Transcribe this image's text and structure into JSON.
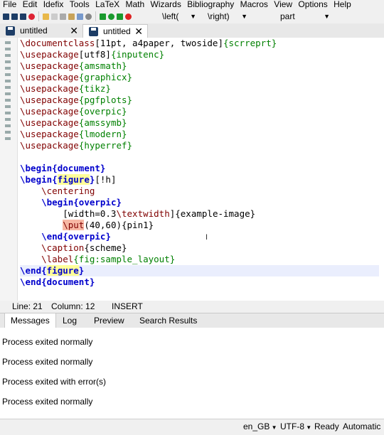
{
  "menu": [
    "File",
    "Edit",
    "Idefix",
    "Tools",
    "LaTeX",
    "Math",
    "Wizards",
    "Bibliography",
    "Macros",
    "View",
    "Options",
    "Help"
  ],
  "toolbar": {
    "left_combo": "\\left(",
    "right_combo": "\\right)",
    "structure_combo": "part"
  },
  "tabs": [
    {
      "label": "untitled",
      "close": "✕"
    },
    {
      "label": "untitled",
      "close": "✕"
    }
  ],
  "editor": {
    "lines": [
      [
        [
          "cmd",
          "\\documentclass"
        ],
        [
          "plain",
          "[11pt, a4paper, twoside]"
        ],
        [
          "arg",
          "{scrreprt}"
        ]
      ],
      [
        [
          "cmd",
          "\\usepackage"
        ],
        [
          "plain",
          "[utf8]"
        ],
        [
          "arg",
          "{inputenc}"
        ]
      ],
      [
        [
          "cmd",
          "\\usepackage"
        ],
        [
          "arg",
          "{amsmath}"
        ]
      ],
      [
        [
          "cmd",
          "\\usepackage"
        ],
        [
          "arg",
          "{graphicx}"
        ]
      ],
      [
        [
          "cmd",
          "\\usepackage"
        ],
        [
          "arg",
          "{tikz}"
        ]
      ],
      [
        [
          "cmd",
          "\\usepackage"
        ],
        [
          "arg",
          "{pgfplots}"
        ]
      ],
      [
        [
          "cmd",
          "\\usepackage"
        ],
        [
          "arg",
          "{overpic}"
        ]
      ],
      [
        [
          "cmd",
          "\\usepackage"
        ],
        [
          "arg",
          "{amssymb}"
        ]
      ],
      [
        [
          "cmd",
          "\\usepackage"
        ],
        [
          "arg",
          "{lmodern}"
        ]
      ],
      [
        [
          "cmd",
          "\\usepackage"
        ],
        [
          "arg",
          "{hyperref}"
        ]
      ],
      [],
      [
        [
          "env",
          "\\begin{"
        ],
        [
          "envname",
          "document"
        ],
        [
          "env",
          "}"
        ]
      ],
      [
        [
          "envhl",
          "\\begin{"
        ],
        [
          "envnamehl",
          "figure"
        ],
        [
          "envhl",
          "}"
        ],
        [
          "plain",
          "[!h]"
        ]
      ],
      [
        [
          "plain",
          "    "
        ],
        [
          "cmd",
          "\\centering"
        ]
      ],
      [
        [
          "plain",
          "    "
        ],
        [
          "env",
          "\\begin{"
        ],
        [
          "envname",
          "overpic"
        ],
        [
          "env",
          "}"
        ]
      ],
      [
        [
          "plain",
          "        [width=0.3"
        ],
        [
          "cmd",
          "\\textwidth"
        ],
        [
          "plain",
          "]{example-image}"
        ]
      ],
      [
        [
          "plain",
          "        "
        ],
        [
          "err",
          "\\put"
        ],
        [
          "plain",
          "(40,60){pin1}"
        ]
      ],
      [
        [
          "plain",
          "    "
        ],
        [
          "env",
          "\\end{"
        ],
        [
          "envname",
          "overpic"
        ],
        [
          "env",
          "}"
        ]
      ],
      [
        [
          "plain",
          "    "
        ],
        [
          "cmd",
          "\\caption"
        ],
        [
          "plain",
          "{scheme}"
        ]
      ],
      [
        [
          "plain",
          "    "
        ],
        [
          "cmd",
          "\\label"
        ],
        [
          "arg",
          "{fig:sample_layout}"
        ]
      ],
      [
        [
          "envhl",
          "\\end{"
        ],
        [
          "envnamehl",
          "figure"
        ],
        [
          "envhl",
          "}"
        ]
      ],
      [
        [
          "env",
          "\\end{"
        ],
        [
          "envname",
          "document"
        ],
        [
          "env",
          "}"
        ]
      ]
    ],
    "highlighted_line": 20
  },
  "status": {
    "line": "Line: 21",
    "column": "Column: 12",
    "mode": "INSERT"
  },
  "panel": {
    "tabs": [
      "Messages",
      "Log",
      "Preview",
      "Search Results"
    ],
    "messages": [
      "Process exited normally",
      "Process exited normally",
      "Process exited with error(s)",
      "Process exited normally"
    ]
  },
  "bottombar": {
    "language": "en_GB",
    "encoding": "UTF-8",
    "state": "Ready",
    "mode": "Automatic"
  },
  "colors": {
    "command": "#800000",
    "argument": "#008000",
    "environment": "#0000cc",
    "current_line": "#eaeefd",
    "match_highlight": "#ffff99",
    "error_highlight": "#f7b8a4"
  }
}
